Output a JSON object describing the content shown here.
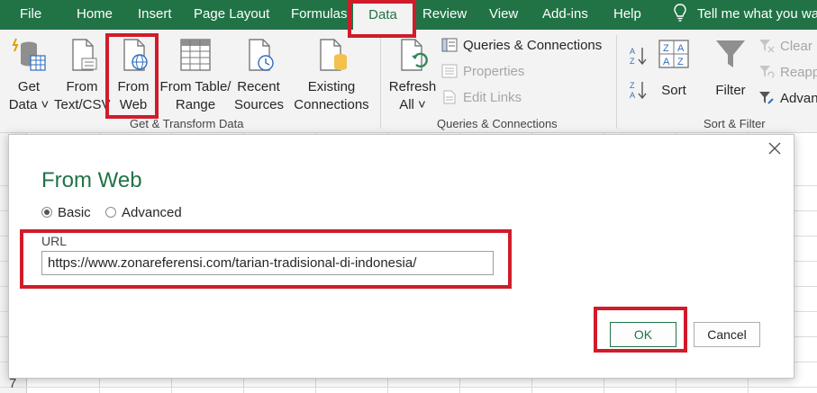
{
  "tabs": [
    {
      "label": "File"
    },
    {
      "label": "Home"
    },
    {
      "label": "Insert"
    },
    {
      "label": "Page Layout"
    },
    {
      "label": "Formulas"
    },
    {
      "label": "Data",
      "active": true
    },
    {
      "label": "Review"
    },
    {
      "label": "View"
    },
    {
      "label": "Add-ins"
    },
    {
      "label": "Help"
    }
  ],
  "tellme": {
    "label": "Tell me what you wa",
    "icon": "lightbulb-icon"
  },
  "ribbon": {
    "get_transform": {
      "get_data": {
        "line1": "Get",
        "line2": "Data ˅"
      },
      "from_text_csv": {
        "line1": "From",
        "line2": "Text/CSV"
      },
      "from_web": {
        "line1": "From",
        "line2": "Web"
      },
      "from_table": {
        "line1": "From Table/",
        "line2": "Range"
      },
      "recent_sources": {
        "line1": "Recent",
        "line2": "Sources"
      },
      "existing_connections": {
        "line1": "Existing",
        "line2": "Connections"
      },
      "group_label": "Get & Transform Data"
    },
    "queries": {
      "refresh_all": {
        "line1": "Refresh",
        "line2": "All ˅"
      },
      "queries_connections": "Queries & Connections",
      "properties": "Properties",
      "edit_links": "Edit Links",
      "group_label": "Queries & Connections"
    },
    "sort_filter": {
      "sort_az": "A↓Z",
      "sort_za": "Z↓A",
      "sort": "Sort",
      "filter": "Filter",
      "clear": "Clear",
      "reapply": "Reapp",
      "advanced": "Advan",
      "group_label": "Sort & Filter"
    }
  },
  "dialog": {
    "title": "From Web",
    "mode_basic": "Basic",
    "mode_advanced": "Advanced",
    "selected_mode": "Basic",
    "url_label": "URL",
    "url_value": "https://www.zonareferensi.com/tarian-tradisional-di-indonesia/",
    "ok_label": "OK",
    "cancel_label": "Cancel"
  },
  "sheet": {
    "row_number": "7"
  },
  "colors": {
    "accent": "#217346",
    "highlight": "#d01c2a"
  }
}
